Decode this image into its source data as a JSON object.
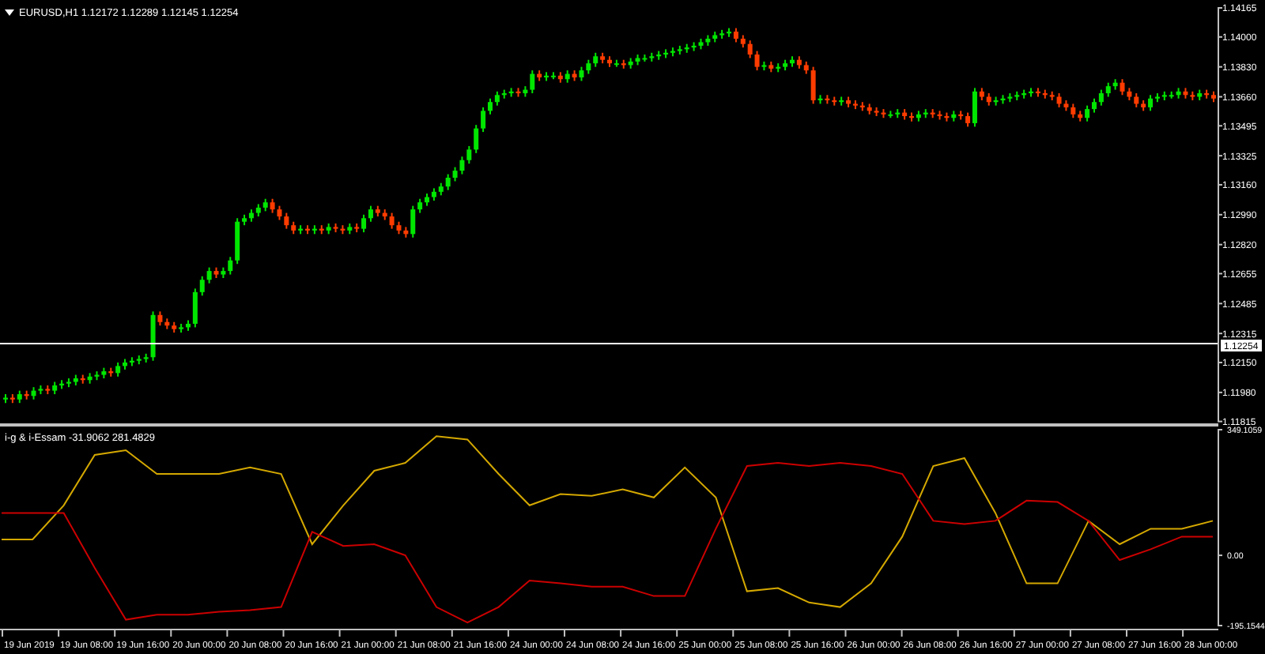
{
  "price_chart": {
    "title": "EURUSD,H1  1.12172 1.12289 1.12145 1.12254",
    "current_price": "1.12254",
    "chart_data": {
      "type": "candlestick",
      "ylim": [
        1.11815,
        1.14165
      ],
      "yticks": [
        {
          "value": 1.14165,
          "label": "1.14165"
        },
        {
          "value": 1.14,
          "label": "1.14000"
        },
        {
          "value": 1.1383,
          "label": "1.13830"
        },
        {
          "value": 1.1366,
          "label": "1.13660"
        },
        {
          "value": 1.13495,
          "label": "1.13495"
        },
        {
          "value": 1.13325,
          "label": "1.13325"
        },
        {
          "value": 1.1316,
          "label": "1.13160"
        },
        {
          "value": 1.1299,
          "label": "1.12990"
        },
        {
          "value": 1.1282,
          "label": "1.12820"
        },
        {
          "value": 1.12655,
          "label": "1.12655"
        },
        {
          "value": 1.12485,
          "label": "1.12485"
        },
        {
          "value": 1.12315,
          "label": "1.12315"
        },
        {
          "value": 1.1215,
          "label": "1.12150"
        },
        {
          "value": 1.1198,
          "label": "1.11980"
        },
        {
          "value": 1.11815,
          "label": "1.11815"
        }
      ],
      "categories": [
        null,
        null,
        null,
        null,
        null,
        null,
        null,
        null,
        null,
        null,
        null,
        null,
        null,
        null,
        null,
        null,
        null,
        null,
        null,
        null,
        null,
        null,
        null,
        null,
        null,
        null,
        null,
        null,
        null,
        null,
        null,
        null,
        null,
        null,
        null,
        null,
        null,
        null,
        null,
        null,
        null,
        null,
        null,
        null,
        null,
        null,
        null,
        null,
        null,
        null,
        null,
        null,
        null,
        null,
        null,
        null,
        null,
        null,
        null,
        null,
        null,
        null,
        null,
        null,
        null,
        null,
        null,
        null,
        null,
        null,
        null,
        null,
        null,
        null,
        null,
        null,
        null,
        null,
        null,
        null,
        null,
        null,
        null,
        null,
        null,
        null,
        null,
        null,
        null,
        null,
        null,
        null,
        null,
        null,
        null,
        null,
        null,
        null,
        null,
        null,
        null,
        null,
        null,
        null,
        null,
        null,
        null,
        null,
        null,
        null,
        null,
        null,
        null,
        null,
        null,
        null,
        null,
        null,
        null,
        null,
        null,
        null,
        null,
        null,
        null,
        null,
        null,
        null,
        null,
        null,
        null,
        null,
        null,
        null,
        null,
        null,
        null,
        null,
        null,
        null,
        null,
        null,
        null,
        null,
        null,
        null,
        null,
        null,
        null,
        null,
        null,
        null,
        null,
        null,
        null,
        null,
        null,
        null,
        null,
        null,
        null,
        null,
        null,
        null,
        null,
        null,
        null,
        null,
        null,
        null,
        null,
        null,
        null
      ],
      "ohlc": [
        [
          1.1194,
          1.1197,
          1.1192,
          1.1195
        ],
        [
          1.1195,
          1.1197,
          1.1192,
          1.1194
        ],
        [
          1.1194,
          1.1199,
          1.1192,
          1.1197
        ],
        [
          1.1197,
          1.1199,
          1.1194,
          1.1196
        ],
        [
          1.1196,
          1.1201,
          1.1194,
          1.1199
        ],
        [
          1.1199,
          1.1202,
          1.1197,
          1.12
        ],
        [
          1.12,
          1.1202,
          1.1197,
          1.1199
        ],
        [
          1.1199,
          1.1204,
          1.1197,
          1.1202
        ],
        [
          1.1202,
          1.1205,
          1.12,
          1.1203
        ],
        [
          1.1203,
          1.1206,
          1.1201,
          1.1204
        ],
        [
          1.1204,
          1.1208,
          1.1202,
          1.1206
        ],
        [
          1.1206,
          1.1208,
          1.1203,
          1.1205
        ],
        [
          1.1205,
          1.1209,
          1.1203,
          1.1207
        ],
        [
          1.1207,
          1.121,
          1.1205,
          1.1208
        ],
        [
          1.1208,
          1.1212,
          1.1206,
          1.121
        ],
        [
          1.121,
          1.1212,
          1.1207,
          1.1209
        ],
        [
          1.1209,
          1.1215,
          1.1207,
          1.1213
        ],
        [
          1.1213,
          1.1217,
          1.1211,
          1.1215
        ],
        [
          1.1215,
          1.1218,
          1.1213,
          1.1216
        ],
        [
          1.1216,
          1.1219,
          1.1214,
          1.1217
        ],
        [
          1.1217,
          1.122,
          1.1215,
          1.1218
        ],
        [
          1.1218,
          1.1244,
          1.1216,
          1.1242
        ],
        [
          1.1242,
          1.1244,
          1.1236,
          1.1238
        ],
        [
          1.1238,
          1.124,
          1.1234,
          1.1236
        ],
        [
          1.1236,
          1.1238,
          1.1232,
          1.1234
        ],
        [
          1.1234,
          1.1237,
          1.1232,
          1.1235
        ],
        [
          1.1235,
          1.1239,
          1.1233,
          1.1237
        ],
        [
          1.1237,
          1.1257,
          1.1235,
          1.1255
        ],
        [
          1.1255,
          1.1264,
          1.1253,
          1.1262
        ],
        [
          1.1262,
          1.1269,
          1.126,
          1.1267
        ],
        [
          1.1267,
          1.1269,
          1.1263,
          1.1265
        ],
        [
          1.1265,
          1.1269,
          1.1263,
          1.1267
        ],
        [
          1.1267,
          1.1275,
          1.1265,
          1.1273
        ],
        [
          1.1273,
          1.1297,
          1.1271,
          1.1295
        ],
        [
          1.1295,
          1.1299,
          1.1293,
          1.1297
        ],
        [
          1.1297,
          1.1302,
          1.1295,
          1.13
        ],
        [
          1.13,
          1.1305,
          1.1298,
          1.1303
        ],
        [
          1.1303,
          1.1308,
          1.1301,
          1.1306
        ],
        [
          1.1306,
          1.1308,
          1.13,
          1.1302
        ],
        [
          1.1302,
          1.1304,
          1.1296,
          1.1298
        ],
        [
          1.1298,
          1.13,
          1.1291,
          1.1293
        ],
        [
          1.1293,
          1.1295,
          1.1288,
          1.129
        ],
        [
          1.129,
          1.1293,
          1.1288,
          1.1291
        ],
        [
          1.1291,
          1.1293,
          1.1288,
          1.129
        ],
        [
          1.129,
          1.1293,
          1.1288,
          1.1291
        ],
        [
          1.1291,
          1.1293,
          1.1288,
          1.129
        ],
        [
          1.129,
          1.1294,
          1.1288,
          1.1292
        ],
        [
          1.1292,
          1.1294,
          1.1289,
          1.1291
        ],
        [
          1.1291,
          1.1293,
          1.1288,
          1.129
        ],
        [
          1.129,
          1.1294,
          1.1288,
          1.1292
        ],
        [
          1.1292,
          1.1294,
          1.1289,
          1.1291
        ],
        [
          1.1291,
          1.1299,
          1.1289,
          1.1297
        ],
        [
          1.1297,
          1.1304,
          1.1295,
          1.1302
        ],
        [
          1.1302,
          1.1304,
          1.1298,
          1.13
        ],
        [
          1.13,
          1.1302,
          1.1296,
          1.1298
        ],
        [
          1.1298,
          1.13,
          1.1291,
          1.1293
        ],
        [
          1.1293,
          1.1295,
          1.1288,
          1.129
        ],
        [
          1.129,
          1.1292,
          1.1286,
          1.1288
        ],
        [
          1.1288,
          1.1304,
          1.1286,
          1.1302
        ],
        [
          1.1302,
          1.1308,
          1.13,
          1.1306
        ],
        [
          1.1306,
          1.1311,
          1.1304,
          1.1309
        ],
        [
          1.1309,
          1.1314,
          1.1307,
          1.1312
        ],
        [
          1.1312,
          1.1317,
          1.131,
          1.1315
        ],
        [
          1.1315,
          1.1322,
          1.1313,
          1.132
        ],
        [
          1.132,
          1.1326,
          1.1318,
          1.1324
        ],
        [
          1.1324,
          1.1332,
          1.1322,
          1.133
        ],
        [
          1.133,
          1.1338,
          1.1328,
          1.1336
        ],
        [
          1.1336,
          1.135,
          1.1334,
          1.1348
        ],
        [
          1.1348,
          1.136,
          1.1346,
          1.1358
        ],
        [
          1.1358,
          1.1365,
          1.1356,
          1.1363
        ],
        [
          1.1363,
          1.1369,
          1.1361,
          1.1367
        ],
        [
          1.1367,
          1.137,
          1.1365,
          1.1368
        ],
        [
          1.1368,
          1.1371,
          1.1366,
          1.1369
        ],
        [
          1.1369,
          1.1371,
          1.1366,
          1.1368
        ],
        [
          1.1368,
          1.1372,
          1.1366,
          1.137
        ],
        [
          1.137,
          1.1381,
          1.1368,
          1.1379
        ],
        [
          1.1379,
          1.1381,
          1.1375,
          1.1377
        ],
        [
          1.1377,
          1.138,
          1.1375,
          1.1378
        ],
        [
          1.1378,
          1.138,
          1.1376,
          1.1378
        ],
        [
          1.1378,
          1.138,
          1.1374,
          1.1376
        ],
        [
          1.1376,
          1.1381,
          1.1374,
          1.1379
        ],
        [
          1.1379,
          1.1381,
          1.1375,
          1.1377
        ],
        [
          1.1377,
          1.1383,
          1.1375,
          1.1381
        ],
        [
          1.1381,
          1.1387,
          1.1379,
          1.1385
        ],
        [
          1.1385,
          1.1391,
          1.1383,
          1.1389
        ],
        [
          1.1389,
          1.1391,
          1.1385,
          1.1387
        ],
        [
          1.1387,
          1.1389,
          1.1383,
          1.1385
        ],
        [
          1.1385,
          1.1387,
          1.1383,
          1.1385
        ],
        [
          1.1385,
          1.1387,
          1.1382,
          1.1384
        ],
        [
          1.1384,
          1.1388,
          1.1382,
          1.1386
        ],
        [
          1.1386,
          1.139,
          1.1384,
          1.1388
        ],
        [
          1.1388,
          1.139,
          1.1386,
          1.1388
        ],
        [
          1.1388,
          1.1391,
          1.1386,
          1.1389
        ],
        [
          1.1389,
          1.1392,
          1.1387,
          1.139
        ],
        [
          1.139,
          1.1393,
          1.1388,
          1.1391
        ],
        [
          1.1391,
          1.1394,
          1.1389,
          1.1392
        ],
        [
          1.1392,
          1.1395,
          1.139,
          1.1393
        ],
        [
          1.1393,
          1.1396,
          1.1391,
          1.1394
        ],
        [
          1.1394,
          1.1397,
          1.1392,
          1.1395
        ],
        [
          1.1395,
          1.1399,
          1.1393,
          1.1397
        ],
        [
          1.1397,
          1.1401,
          1.1395,
          1.1399
        ],
        [
          1.1399,
          1.1403,
          1.1397,
          1.1401
        ],
        [
          1.1401,
          1.1404,
          1.1399,
          1.1402
        ],
        [
          1.1402,
          1.1405,
          1.14,
          1.1403
        ],
        [
          1.1403,
          1.1405,
          1.1397,
          1.1399
        ],
        [
          1.1399,
          1.1401,
          1.1394,
          1.1396
        ],
        [
          1.1396,
          1.1398,
          1.1388,
          1.139
        ],
        [
          1.139,
          1.1392,
          1.1381,
          1.1383
        ],
        [
          1.1383,
          1.1386,
          1.1381,
          1.1384
        ],
        [
          1.1384,
          1.1386,
          1.138,
          1.1382
        ],
        [
          1.1382,
          1.1385,
          1.138,
          1.1383
        ],
        [
          1.1383,
          1.1387,
          1.1381,
          1.1385
        ],
        [
          1.1385,
          1.1389,
          1.1383,
          1.1387
        ],
        [
          1.1387,
          1.1389,
          1.1382,
          1.1384
        ],
        [
          1.1384,
          1.1386,
          1.1379,
          1.1381
        ],
        [
          1.1381,
          1.1383,
          1.1362,
          1.1364
        ],
        [
          1.1364,
          1.1367,
          1.1362,
          1.1365
        ],
        [
          1.1365,
          1.1367,
          1.1362,
          1.1364
        ],
        [
          1.1364,
          1.1366,
          1.1361,
          1.1363
        ],
        [
          1.1363,
          1.1366,
          1.1361,
          1.1364
        ],
        [
          1.1364,
          1.1366,
          1.136,
          1.1362
        ],
        [
          1.1362,
          1.1364,
          1.1359,
          1.1361
        ],
        [
          1.1361,
          1.1363,
          1.1358,
          1.136
        ],
        [
          1.136,
          1.1362,
          1.1356,
          1.1358
        ],
        [
          1.1358,
          1.136,
          1.1355,
          1.1357
        ],
        [
          1.1357,
          1.1359,
          1.1354,
          1.1356
        ],
        [
          1.1356,
          1.1358,
          1.1354,
          1.1356
        ],
        [
          1.1356,
          1.1359,
          1.1354,
          1.1357
        ],
        [
          1.1357,
          1.1359,
          1.1353,
          1.1355
        ],
        [
          1.1355,
          1.1357,
          1.1352,
          1.1354
        ],
        [
          1.1354,
          1.1358,
          1.1352,
          1.1356
        ],
        [
          1.1356,
          1.1359,
          1.1354,
          1.1357
        ],
        [
          1.1357,
          1.1359,
          1.1354,
          1.1356
        ],
        [
          1.1356,
          1.1358,
          1.1353,
          1.1355
        ],
        [
          1.1355,
          1.1357,
          1.1352,
          1.1354
        ],
        [
          1.1354,
          1.1358,
          1.1352,
          1.1356
        ],
        [
          1.1356,
          1.1358,
          1.1353,
          1.1355
        ],
        [
          1.1355,
          1.1357,
          1.1349,
          1.1351
        ],
        [
          1.1351,
          1.1371,
          1.1349,
          1.1369
        ],
        [
          1.1369,
          1.1371,
          1.1364,
          1.1366
        ],
        [
          1.1366,
          1.1368,
          1.1361,
          1.1363
        ],
        [
          1.1363,
          1.1366,
          1.1361,
          1.1364
        ],
        [
          1.1364,
          1.1367,
          1.1362,
          1.1365
        ],
        [
          1.1365,
          1.1368,
          1.1363,
          1.1366
        ],
        [
          1.1366,
          1.1369,
          1.1364,
          1.1367
        ],
        [
          1.1367,
          1.137,
          1.1365,
          1.1368
        ],
        [
          1.1368,
          1.1371,
          1.1366,
          1.1369
        ],
        [
          1.1369,
          1.1371,
          1.1366,
          1.1368
        ],
        [
          1.1368,
          1.137,
          1.1365,
          1.1367
        ],
        [
          1.1367,
          1.1369,
          1.1364,
          1.1366
        ],
        [
          1.1366,
          1.1368,
          1.136,
          1.1362
        ],
        [
          1.1362,
          1.1364,
          1.1358,
          1.136
        ],
        [
          1.136,
          1.1362,
          1.1354,
          1.1356
        ],
        [
          1.1356,
          1.1358,
          1.1352,
          1.1354
        ],
        [
          1.1354,
          1.1361,
          1.1352,
          1.1359
        ],
        [
          1.1359,
          1.1365,
          1.1357,
          1.1363
        ],
        [
          1.1363,
          1.137,
          1.1361,
          1.1368
        ],
        [
          1.1368,
          1.1374,
          1.1366,
          1.1372
        ],
        [
          1.1372,
          1.1376,
          1.137,
          1.1374
        ],
        [
          1.1374,
          1.1376,
          1.1367,
          1.1369
        ],
        [
          1.1369,
          1.1371,
          1.1364,
          1.1366
        ],
        [
          1.1366,
          1.1368,
          1.136,
          1.1362
        ],
        [
          1.1362,
          1.1364,
          1.1358,
          1.136
        ],
        [
          1.136,
          1.1367,
          1.1358,
          1.1365
        ],
        [
          1.1365,
          1.1368,
          1.1363,
          1.1366
        ],
        [
          1.1366,
          1.1369,
          1.1364,
          1.1367
        ],
        [
          1.1367,
          1.1369,
          1.1365,
          1.1367
        ],
        [
          1.1367,
          1.1371,
          1.1365,
          1.1369
        ],
        [
          1.1369,
          1.1371,
          1.1365,
          1.1367
        ],
        [
          1.1367,
          1.1369,
          1.1364,
          1.1366
        ],
        [
          1.1366,
          1.137,
          1.1364,
          1.1368
        ],
        [
          1.1368,
          1.137,
          1.1365,
          1.1367
        ],
        [
          1.1367,
          1.1369,
          1.1363,
          1.1365
        ]
      ]
    }
  },
  "indicator": {
    "title": "i-g & i-Essam -31.9062 281.4829",
    "chart_data": {
      "type": "line",
      "categories": [
        null,
        null,
        null,
        null,
        null,
        null,
        null,
        null,
        null,
        null,
        null,
        null,
        null,
        null,
        null,
        null,
        null,
        null,
        null,
        null,
        null,
        null,
        null,
        null,
        null,
        null,
        null,
        null,
        null,
        null,
        null,
        null,
        null,
        null,
        null,
        null,
        null,
        null,
        null,
        null
      ],
      "ylim": [
        -195.1544,
        349.1059
      ],
      "yticks": [
        {
          "value": 349.1059,
          "label": "349.1059"
        },
        {
          "value": 0,
          "label": "0.00"
        },
        {
          "value": -195.1544,
          "label": "-195.1544"
        }
      ],
      "series": [
        {
          "color": "#d4a800",
          "values": [
            44,
            44,
            139,
            279,
            292,
            226,
            226,
            226,
            244,
            226,
            31,
            139,
            235,
            257,
            331,
            322,
            226,
            139,
            170,
            165,
            183,
            161,
            244,
            161,
            -100,
            -91,
            -131,
            -144,
            -78,
            52,
            248,
            270,
            118,
            -78,
            -78,
            96,
            31,
            74,
            74,
            96
          ]
        },
        {
          "color": "#cc0000",
          "values": [
            118,
            118,
            118,
            -35,
            -179,
            -165,
            -165,
            -157,
            -152,
            -144,
            65,
            26,
            31,
            0,
            -144,
            -187,
            -144,
            -70,
            -78,
            -87,
            -87,
            -113,
            -113,
            74,
            248,
            257,
            248,
            257,
            248,
            226,
            96,
            87,
            96,
            152,
            148,
            96,
            -13,
            17,
            52,
            52
          ]
        }
      ]
    }
  },
  "time_axis": [
    "19 Jun 2019",
    "19 Jun 08:00",
    "19 Jun 16:00",
    "20 Jun 00:00",
    "20 Jun 08:00",
    "20 Jun 16:00",
    "21 Jun 00:00",
    "21 Jun 08:00",
    "21 Jun 16:00",
    "24 Jun 00:00",
    "24 Jun 08:00",
    "24 Jun 16:00",
    "25 Jun 00:00",
    "25 Jun 08:00",
    "25 Jun 16:00",
    "26 Jun 00:00",
    "26 Jun 08:00",
    "26 Jun 16:00",
    "27 Jun 00:00",
    "27 Jun 08:00",
    "27 Jun 16:00",
    "28 Jun 00:00"
  ]
}
